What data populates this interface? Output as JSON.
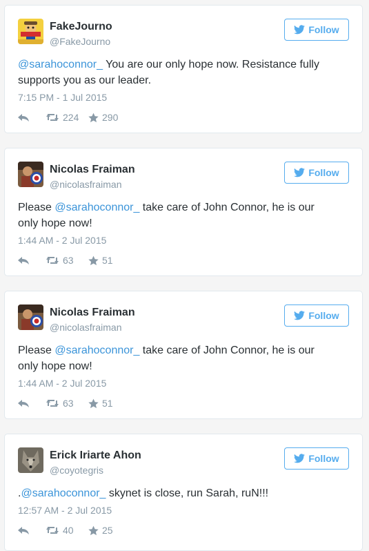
{
  "colors": {
    "accent": "#55acee",
    "mention": "#3b94d9",
    "muted": "#8899a6"
  },
  "tweets": [
    {
      "name": "FakeJourno",
      "handle": "@FakeJourno",
      "follow_label": "Follow",
      "mention": "@sarahoconnor_",
      "text_before": "",
      "text_after": " You are our only hope now. Resistance fully supports you as our leader.",
      "time": "7:15 PM - 1 Jul 2015",
      "retweets": "224",
      "likes": "290",
      "avatar_icon": "cartoon-avatar"
    },
    {
      "name": "Nicolas Fraiman",
      "handle": "@nicolasfraiman",
      "follow_label": "Follow",
      "mention": "@sarahoconnor_",
      "text_before": "Please ",
      "text_after": " take care of John Connor, he is our only hope now!",
      "time": "1:44 AM - 2 Jul 2015",
      "retweets": "63",
      "likes": "51",
      "avatar_icon": "photo-avatar"
    },
    {
      "name": "Nicolas Fraiman",
      "handle": "@nicolasfraiman",
      "follow_label": "Follow",
      "mention": "@sarahoconnor_",
      "text_before": "Please ",
      "text_after": " take care of John Connor, he is our only hope now!",
      "time": "1:44 AM - 2 Jul 2015",
      "retweets": "63",
      "likes": "51",
      "avatar_icon": "photo-avatar"
    },
    {
      "name": "Erick Iriarte Ahon",
      "handle": "@coyotegris",
      "follow_label": "Follow",
      "mention": "@sarahoconnor_",
      "text_before": ".",
      "text_after": " skynet is close, run Sarah, ruN!!!",
      "time": "12:57 AM - 2 Jul 2015",
      "retweets": "40",
      "likes": "25",
      "avatar_icon": "wolf-avatar"
    }
  ]
}
